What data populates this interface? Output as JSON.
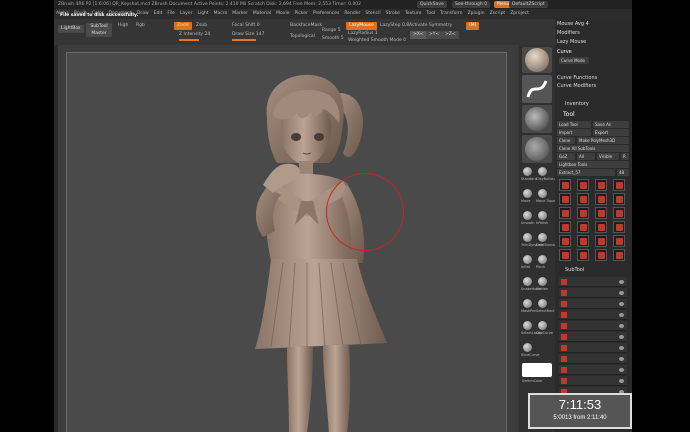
{
  "titlebar": {
    "text": "ZBrush 4R6 P2 [1:6:06] QR_Keyshot.mcd  ZBrush Document  Active Points: 2.410 Mil  Scratch Disk: 2,694  Free Mem: 2,553  Timer: 0.002",
    "quicksave": "QuickSave",
    "seethrough": "See-through 0",
    "menus_btn": "Menus",
    "script": "DefaultZScript"
  },
  "menubar": [
    "Alpha",
    "Brush",
    "Color",
    "Document",
    "Draw",
    "Edit",
    "File",
    "Layer",
    "Light",
    "Macro",
    "Marker",
    "Material",
    "Movie",
    "Picker",
    "Preferences",
    "Render",
    "Stencil",
    "Stroke",
    "Texture",
    "Tool",
    "Transform",
    "Zplugin",
    "Zscript",
    "Zproject"
  ],
  "toolbar": {
    "notice": "File saved to disk successfully.",
    "lightbox": "LightBox",
    "subtool_master": "SubTool Master",
    "high": "High",
    "rgb": "Rgb",
    "zadd": "Zadd",
    "zsub": "Zsub",
    "focal_shift": "Focal Shift 0",
    "zintensity": "Z Intensity 24",
    "draw_size": "Draw Size 147",
    "backface": "BackfaceMask",
    "topological": "Topological",
    "range": "Range 5",
    "smooth": "Smooth 5",
    "lazymouse": "LazyMouse",
    "lazystep": "LazyStep 0.8",
    "lazyradius": "LazyRadius 1",
    "activate_sym": "Activate Symmetry",
    "weighted_smooth": "Weighted Smooth Mode 0",
    "x_btn": ">X<",
    "y_btn": ">Y<",
    "z_btn": ">Z<",
    "m_btn": "(M)"
  },
  "shelf": {
    "brush_labels": [
      "Standard",
      "ClayBuildup",
      "Move",
      "Move Topological",
      "Smooth",
      "hPolish",
      "TrimDynamic",
      "DamStandard",
      "Inflat",
      "Pinch",
      "SnakeHook",
      "Flatten",
      "MaskPen",
      "SelectRect",
      "SelectLasso",
      "ClipCurve",
      "SliceCurve",
      "SwitchColor"
    ]
  },
  "rightpanel": {
    "mouse_avg": "Mouse Avg 4",
    "modifiers": "Modifiers",
    "lazy_mouse": "Lazy Mouse",
    "curve": "Curve",
    "curve_mode": "Curve Mode",
    "curve_functions": "Curve Functions",
    "curve_modifiers": "Curve Modifiers",
    "inventory": "Inventory",
    "tool": "Tool",
    "load_tool": "Load Tool",
    "save_as": "Save As",
    "import": "Import",
    "export": "Export",
    "clone": "Clone",
    "make_polymesh": "Make PolyMesh3D",
    "goz": "GoZ",
    "all": "All",
    "visible": "Visible",
    "r": "R",
    "clone_all": "Clone All SubTools",
    "lightbox_tools": "Lightbox Tools",
    "extract": "Extract_57",
    "extract_num": "48",
    "subtool": "SubTool"
  },
  "timer": {
    "main": "7:11:53",
    "sub": "5:0013 from 2:11:40"
  },
  "colors": {
    "accent": "#e8741f",
    "brush_red": "#c0392b"
  }
}
